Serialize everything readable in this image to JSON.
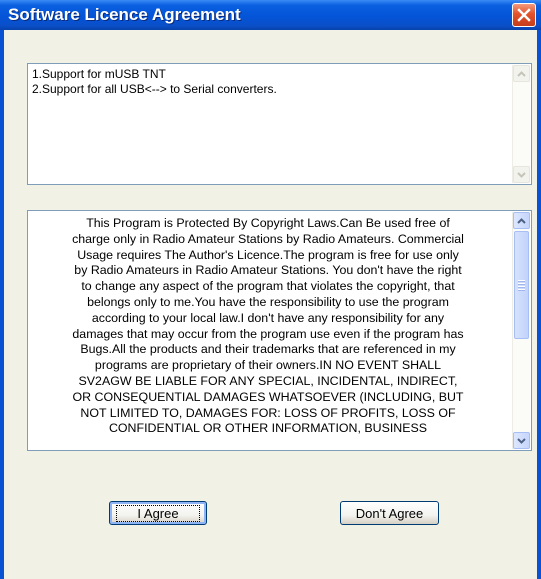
{
  "window": {
    "title": "Software Licence Agreement",
    "close_icon": "close-icon",
    "titlebar_color": "#0454d8",
    "close_color": "#e2522c"
  },
  "changes_box": {
    "lines": [
      "1.Support for mUSB TNT",
      "2.Support for all USB<--> to Serial converters."
    ]
  },
  "license_box": {
    "lines": [
      "This Program is Protected By Copyright Laws.Can Be used  free of",
      "charge only in Radio Amateur Stations by Radio Amateurs. Commercial",
      "Usage requires The Author's Licence.The program  is free for use only",
      "by Radio Amateurs in Radio Amateur Stations. You don't have the right",
      "to change any aspect of the program that  violates the copyright, that",
      "belongs only to me.You have  the responsibility to use the program",
      "according to your local law.I don't have any responsibility for any",
      "damages that may occur from the program use even if the program has",
      "Bugs.All the products and their trademarks that are referenced in my",
      "programs are proprietary of their owners.IN NO EVENT SHALL",
      "SV2AGW BE LIABLE FOR ANY SPECIAL, INCIDENTAL, INDIRECT,",
      "OR CONSEQUENTIAL DAMAGES WHATSOEVER (INCLUDING, BUT",
      "NOT LIMITED TO, DAMAGES FOR:  LOSS OF PROFITS, LOSS OF",
      "CONFIDENTIAL OR OTHER INFORMATION, BUSINESS"
    ]
  },
  "buttons": {
    "agree_label": "I Agree",
    "disagree_label": "Don't Agree"
  }
}
